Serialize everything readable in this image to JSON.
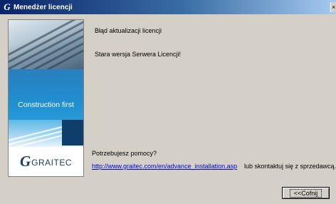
{
  "window": {
    "title": "Menedżer licencji",
    "title_icon": "graitec-g-icon",
    "close_icon": "close-icon"
  },
  "side_panel": {
    "tagline": "Construction first",
    "logo_mark": "G",
    "logo_word": "GRAITEC"
  },
  "messages": {
    "heading": "Błąd aktualizacji licencji",
    "detail": "Stara wersja Serwera Licencji!"
  },
  "help": {
    "question": "Potrzebujesz pomocy?",
    "link_text": "http://www.graitec.com/en/advance_installation.asp",
    "contact_text": "lub skontaktuj się z sprzedawcą."
  },
  "buttons": {
    "back_label": "<<Cofnij"
  },
  "colors": {
    "title_gradient_start": "#0a246a",
    "title_gradient_end": "#a6caf0",
    "dialog_background": "#d4d0c8",
    "link": "#0000ee",
    "brand_blue": "#1f8fd0",
    "brand_dark": "#1b3d6e"
  }
}
